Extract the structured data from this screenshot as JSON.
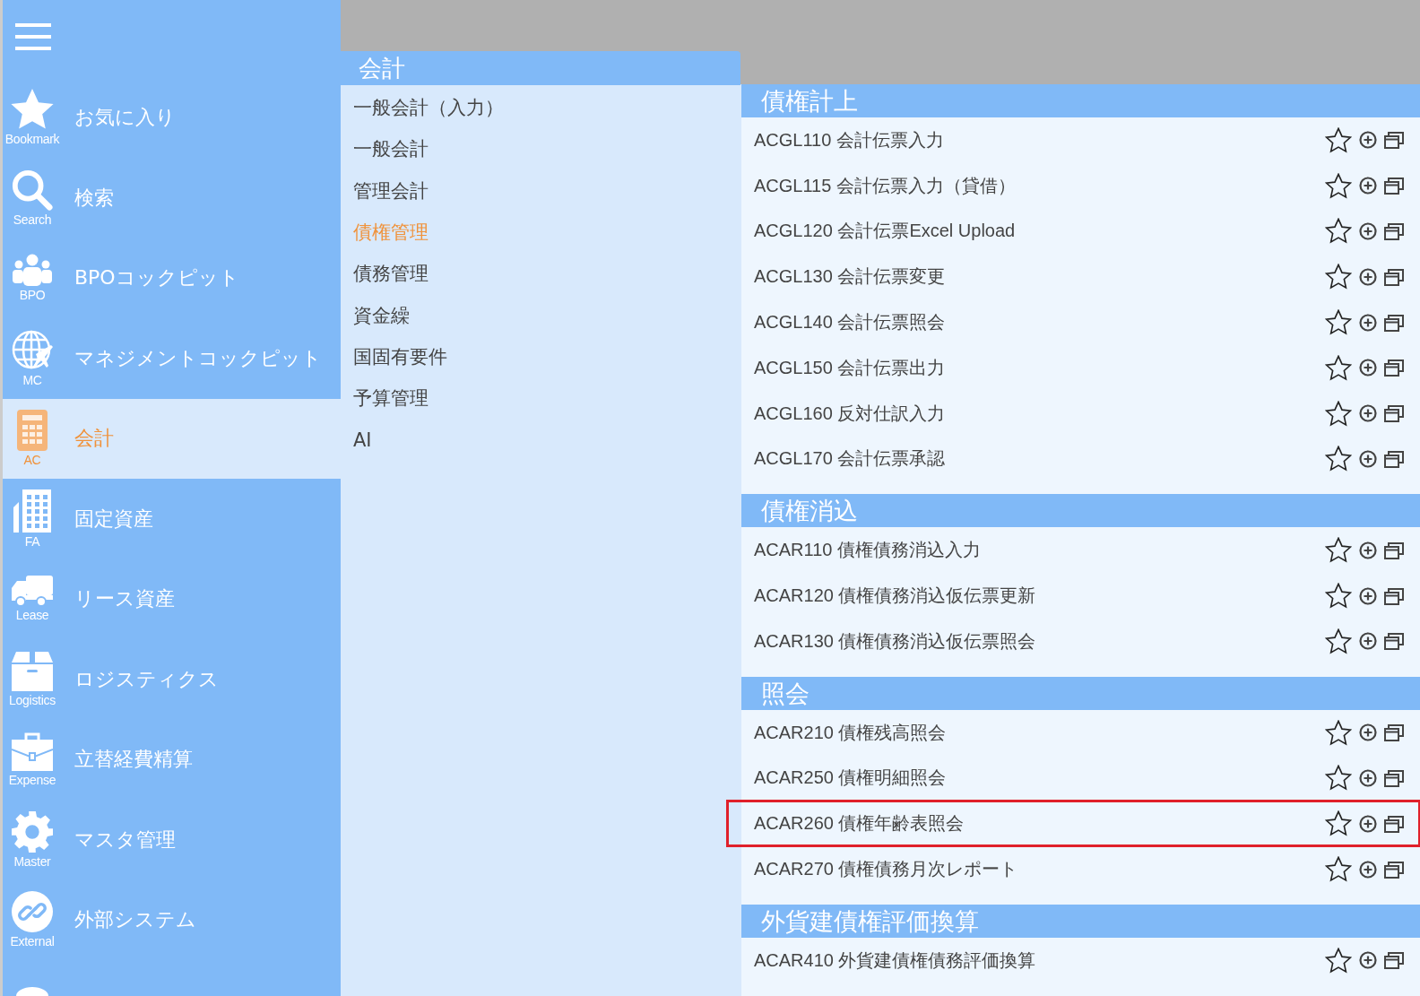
{
  "sidebar": {
    "items": [
      {
        "kind": "star",
        "label": "お気に入り",
        "caption": "Bookmark",
        "selected": false
      },
      {
        "kind": "search",
        "label": "検索",
        "caption": "Search",
        "selected": false
      },
      {
        "kind": "people",
        "label": "BPOコックピット",
        "caption": "BPO",
        "selected": false
      },
      {
        "kind": "globe",
        "label": "マネジメントコックピット",
        "caption": "MC",
        "selected": false
      },
      {
        "kind": "calculator",
        "label": "会計",
        "caption": "AC",
        "selected": true
      },
      {
        "kind": "building",
        "label": "固定資産",
        "caption": "FA",
        "selected": false
      },
      {
        "kind": "truck",
        "label": "リース資産",
        "caption": "Lease",
        "selected": false
      },
      {
        "kind": "box",
        "label": "ロジスティクス",
        "caption": "Logistics",
        "selected": false
      },
      {
        "kind": "briefcase",
        "label": "立替経費精算",
        "caption": "Expense",
        "selected": false
      },
      {
        "kind": "gear",
        "label": "マスタ管理",
        "caption": "Master",
        "selected": false
      },
      {
        "kind": "link",
        "label": "外部システム",
        "caption": "External",
        "selected": false
      },
      {
        "kind": "disc",
        "selected": false
      }
    ]
  },
  "submenu": {
    "title": "会計",
    "items": [
      {
        "label": "一般会計（入力）",
        "selected": false
      },
      {
        "label": "一般会計",
        "selected": false
      },
      {
        "label": "管理会計",
        "selected": false
      },
      {
        "label": "債権管理",
        "selected": true
      },
      {
        "label": "債務管理",
        "selected": false
      },
      {
        "label": "資金繰",
        "selected": false
      },
      {
        "label": "国固有要件",
        "selected": false
      },
      {
        "label": "予算管理",
        "selected": false
      },
      {
        "label": "AI",
        "selected": false
      }
    ]
  },
  "sections": [
    {
      "title": "債権計上",
      "items": [
        {
          "label": "ACGL110 会計伝票入力",
          "highlighted": false
        },
        {
          "label": "ACGL115 会計伝票入力（貸借）",
          "highlighted": false
        },
        {
          "label": "ACGL120 会計伝票Excel Upload",
          "highlighted": false
        },
        {
          "label": "ACGL130 会計伝票変更",
          "highlighted": false
        },
        {
          "label": "ACGL140 会計伝票照会",
          "highlighted": false
        },
        {
          "label": "ACGL150 会計伝票出力",
          "highlighted": false
        },
        {
          "label": "ACGL160 反対仕訳入力",
          "highlighted": false
        },
        {
          "label": "ACGL170 会計伝票承認",
          "highlighted": false
        }
      ]
    },
    {
      "title": "債権消込",
      "items": [
        {
          "label": "ACAR110 債権債務消込入力",
          "highlighted": false
        },
        {
          "label": "ACAR120 債権債務消込仮伝票更新",
          "highlighted": false
        },
        {
          "label": "ACAR130 債権債務消込仮伝票照会",
          "highlighted": false
        }
      ]
    },
    {
      "title": "照会",
      "items": [
        {
          "label": "ACAR210 債権残高照会",
          "highlighted": false
        },
        {
          "label": "ACAR250 債権明細照会",
          "highlighted": false
        },
        {
          "label": "ACAR260 債権年齢表照会",
          "highlighted": true
        },
        {
          "label": "ACAR270 債権債務月次レポート",
          "highlighted": false
        }
      ]
    },
    {
      "title": "外貨建債権評価換算",
      "items": [
        {
          "label": "ACAR410 外貨建債権債務評価換算",
          "highlighted": false
        }
      ]
    }
  ]
}
